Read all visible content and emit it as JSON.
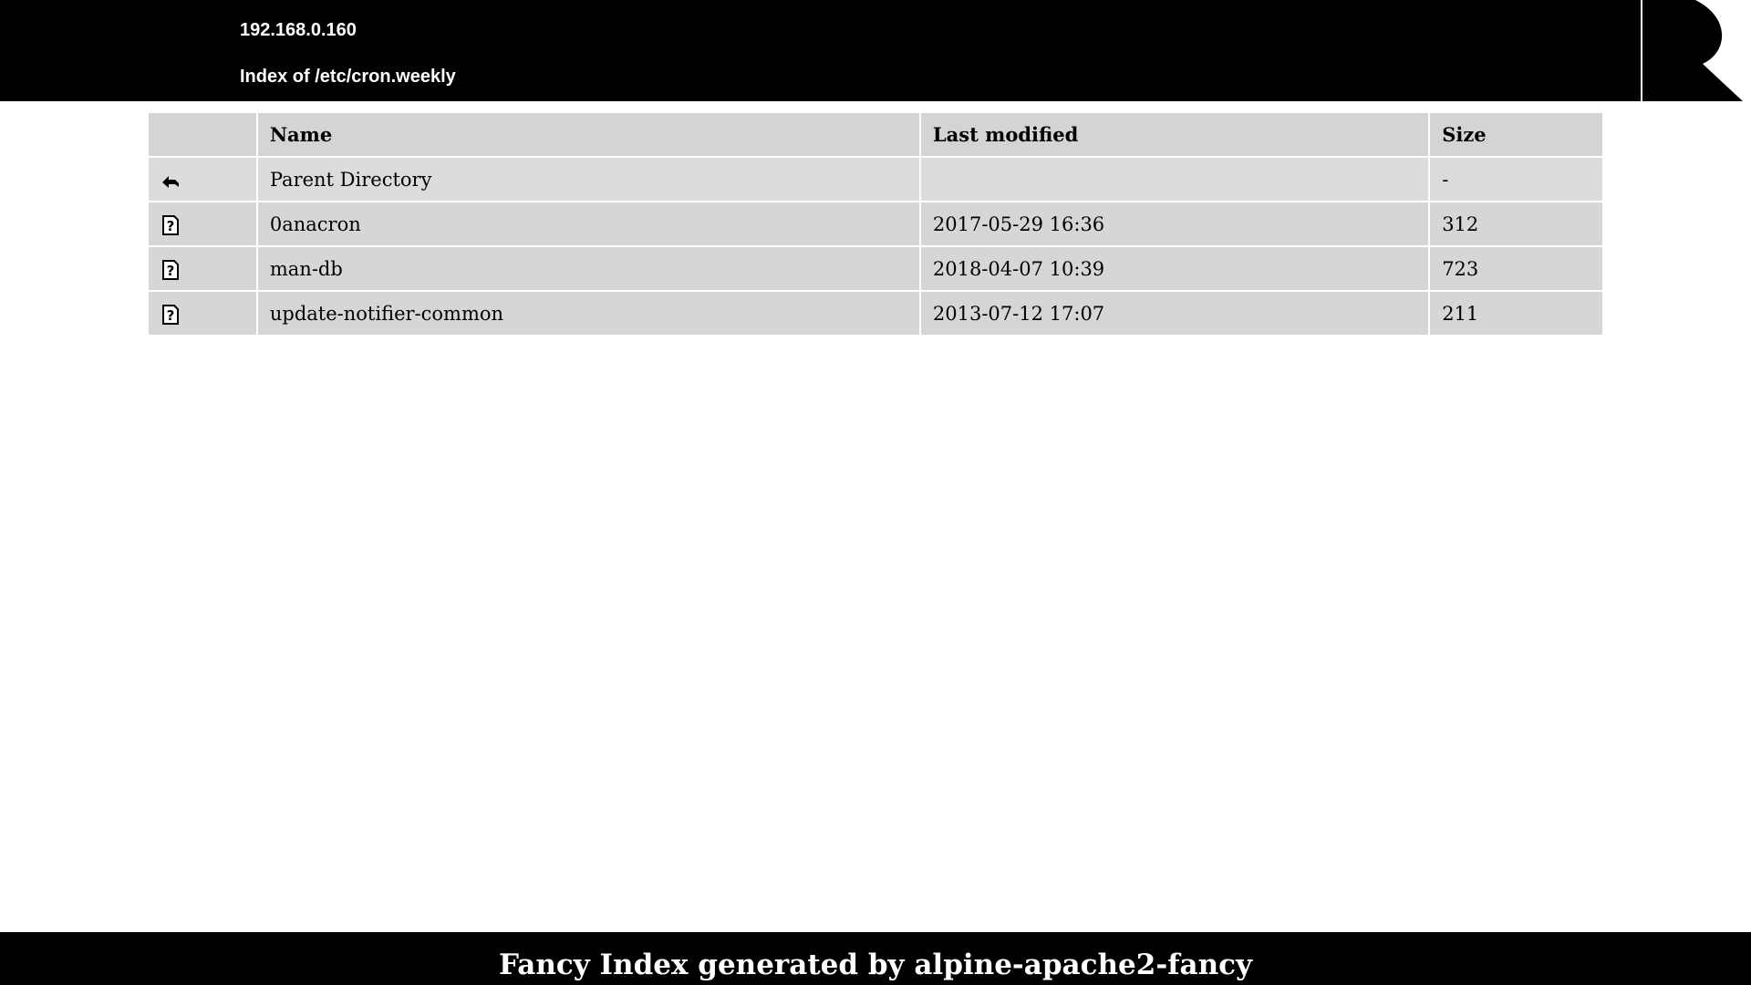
{
  "header": {
    "host": "192.168.0.160",
    "title": "Index of /etc/cron.weekly"
  },
  "table": {
    "columns": [
      "",
      "Name",
      "Last modified",
      "Size"
    ],
    "rows": [
      {
        "icon": "back-arrow-icon",
        "name": "Parent Directory",
        "modified": "",
        "size": "-"
      },
      {
        "icon": "unknown-file-icon",
        "name": "0anacron",
        "modified": "2017-05-29 16:36",
        "size": "312"
      },
      {
        "icon": "unknown-file-icon",
        "name": "man-db",
        "modified": "2018-04-07 10:39",
        "size": "723"
      },
      {
        "icon": "unknown-file-icon",
        "name": "update-notifier-common",
        "modified": "2013-07-12 17:07",
        "size": "211"
      }
    ]
  },
  "footer": {
    "text": "Fancy Index generated by alpine-apache2-fancy"
  },
  "colors": {
    "header_bg": "#000000",
    "row_bg": "#dcdcdc",
    "header_row_bg": "#d4d4d4"
  }
}
